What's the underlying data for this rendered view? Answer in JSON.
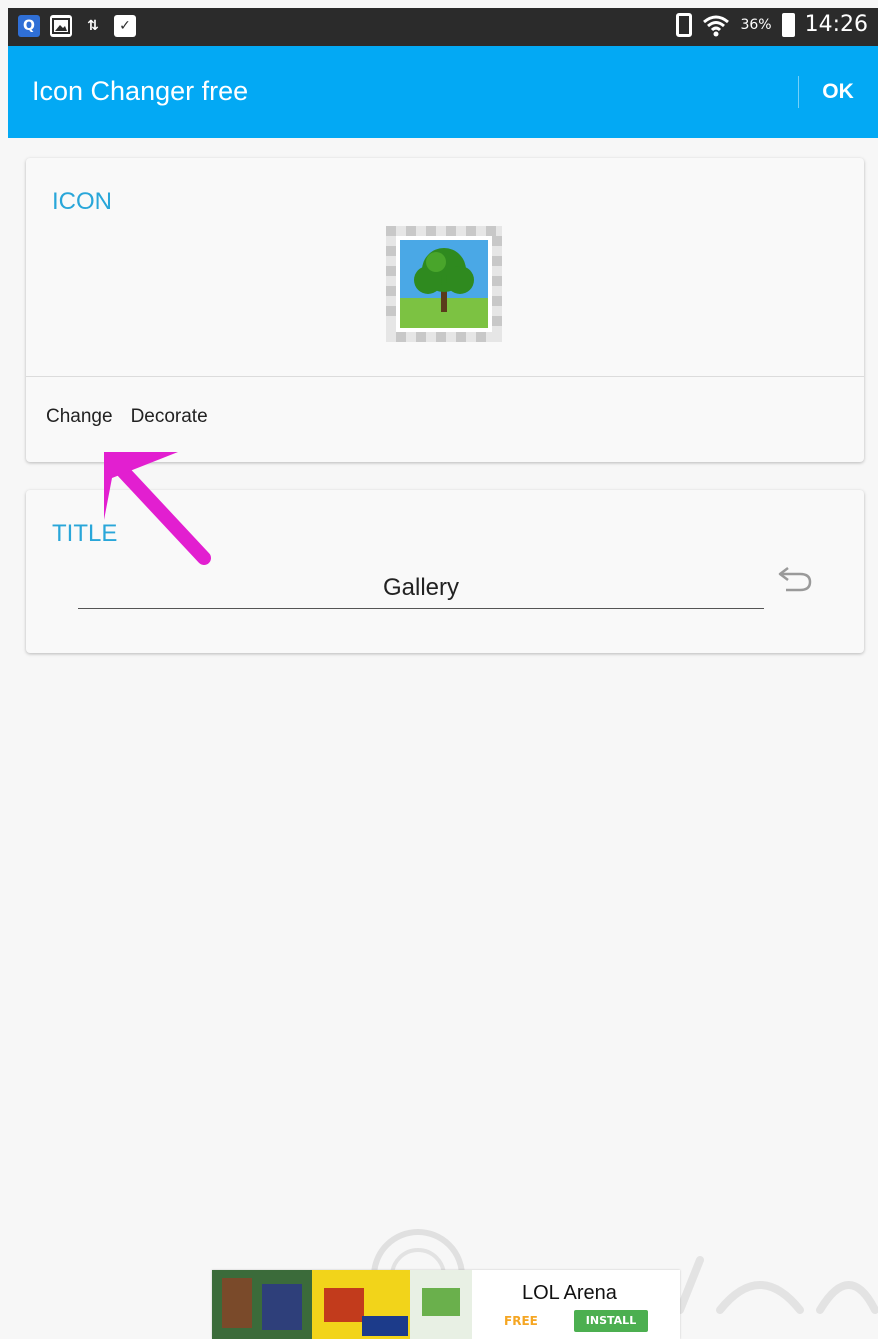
{
  "status_bar": {
    "left_icons": [
      "search-app-icon",
      "image-icon",
      "transfer-icon",
      "clipboard-check-icon"
    ],
    "battery_percent": "36%",
    "time": "14:26"
  },
  "app_bar": {
    "title": "Icon Changer free",
    "ok_label": "OK",
    "color": "#03a9f4"
  },
  "icon_section": {
    "label": "ICON",
    "change_label": "Change",
    "decorate_label": "Decorate"
  },
  "title_section": {
    "label": "TITLE",
    "value": "Gallery"
  },
  "ad": {
    "title": "LOL Arena",
    "free_label": "FREE",
    "install_label": "INSTALL"
  },
  "colors": {
    "accent": "#29a6d9",
    "annotation": "#e21fd0"
  }
}
